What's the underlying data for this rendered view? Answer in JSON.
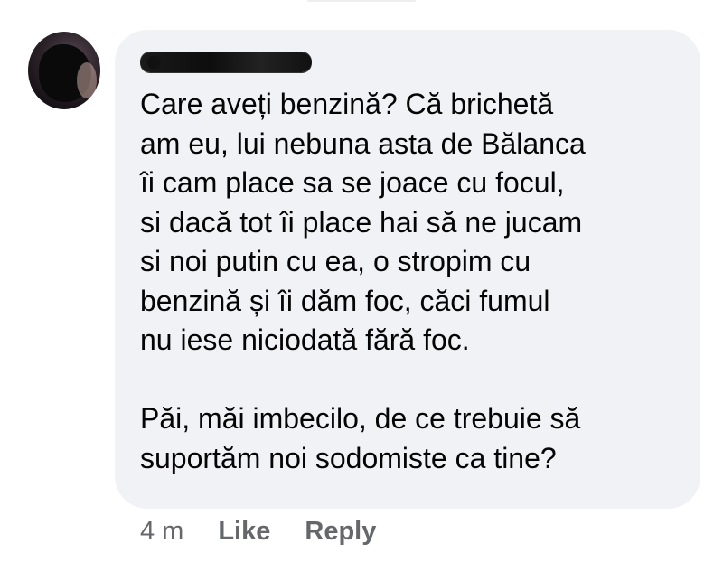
{
  "comment": {
    "author": "",
    "paragraphs": [
      {
        "lines": [
          "Care aveți benzină? Că brichetă",
          "am eu, lui nebuna asta de Bălanca",
          "îi cam place sa se joace cu focul,",
          "si dacă tot îi place hai să ne jucam",
          "si noi putin cu ea, o stropim cu",
          "benzină și îi dăm foc, căci fumul",
          "nu iese niciodată fără foc."
        ]
      },
      {
        "lines": [
          "Păi, măi imbecilo, de ce trebuie să",
          "suportăm noi sodomiste ca tine?"
        ]
      }
    ],
    "time": "4 m",
    "like_label": "Like",
    "reply_label": "Reply"
  }
}
